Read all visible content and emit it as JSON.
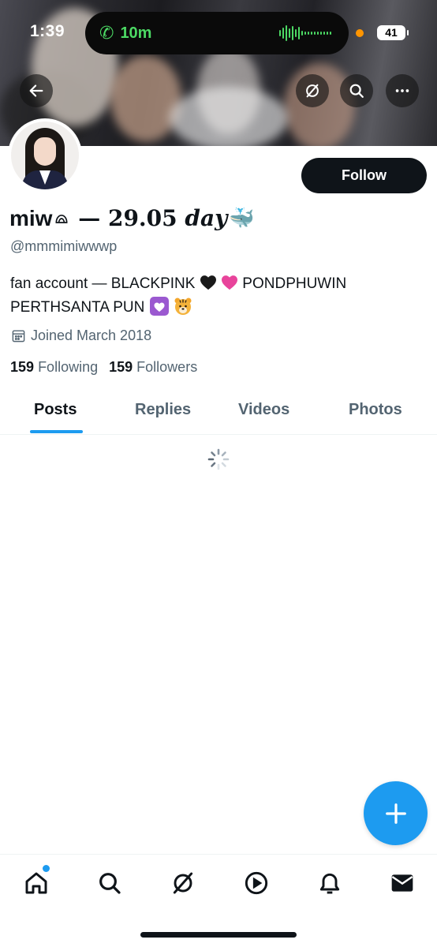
{
  "status_bar": {
    "time": "1:39",
    "call_duration": "10m",
    "battery": "41"
  },
  "profile": {
    "display_name_prefix": "miw",
    "display_name_mid": " — 29.05 ",
    "display_name_italic": "day",
    "display_name_emoji": "🐳",
    "handle": "@mmmimiwwwp",
    "bio_line1_text": "fan account — BLACKPINK",
    "bio_line1_after": "PONDPHUWIN",
    "bio_line2_text": "PERTHSANTA PUN",
    "joined": "Joined March 2018",
    "following_count": "159",
    "following_label": "Following",
    "followers_count": "159",
    "followers_label": "Followers"
  },
  "actions": {
    "follow_label": "Follow"
  },
  "tabs": [
    {
      "label": "Posts",
      "active": true
    },
    {
      "label": "Replies",
      "active": false
    },
    {
      "label": "Videos",
      "active": false
    },
    {
      "label": "Photos",
      "active": false
    }
  ],
  "colors": {
    "accent": "#1d9bf0",
    "text_primary": "#0f1419",
    "text_secondary": "#536471",
    "call_green": "#4cd964"
  },
  "icons": {
    "back": "arrow-left-icon",
    "grok": "grok-icon",
    "search": "search-icon",
    "more": "more-icon",
    "calendar": "calendar-icon",
    "compose": "plus-icon",
    "nav": [
      "home-icon",
      "search-icon",
      "grok-icon",
      "video-icon",
      "bell-icon",
      "mail-icon"
    ]
  }
}
